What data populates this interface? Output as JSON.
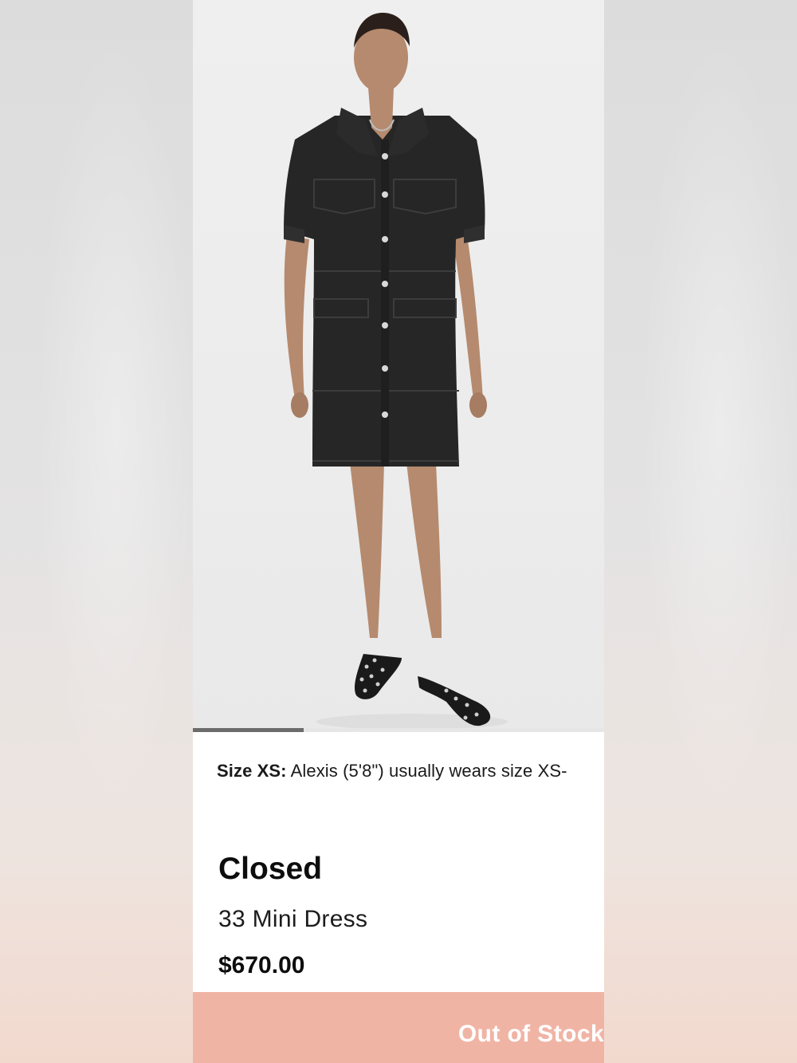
{
  "product": {
    "fit_note_label": "Size XS:",
    "fit_note_text": "Alexis (5'8\") usually wears size XS-",
    "brand": "Closed",
    "name": "33 Mini Dress",
    "price": "$670.00",
    "image_name": "model-wearing-black-denim-mini-dress"
  },
  "carousel": {
    "progress": 0.27
  },
  "actions": {
    "stock_status": "Out of Stock"
  },
  "colors": {
    "accent": "#f0b4a5",
    "text": "#0d0d0d",
    "dress": "#262627"
  }
}
